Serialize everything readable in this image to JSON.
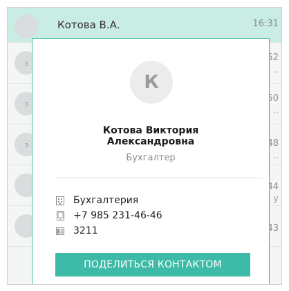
{
  "background_chats": [
    {
      "avatar": "",
      "name": "Котова В.А.",
      "time": "16:31",
      "sub": ""
    },
    {
      "avatar": "з",
      "name": "",
      "time": "52",
      "sub": ".."
    },
    {
      "avatar": "з",
      "name": "",
      "time": "50",
      "sub": ".."
    },
    {
      "avatar": "з",
      "name": "",
      "time": "48",
      "sub": ".."
    },
    {
      "avatar": "",
      "name": "",
      "time": "44",
      "sub": "у"
    },
    {
      "avatar": "",
      "name": "",
      "time": "43",
      "sub": ""
    }
  ],
  "contact": {
    "initial": "К",
    "name_line1": "Котова Виктория",
    "name_line2": "Александровна",
    "position": "Бухгалтер",
    "department": "Бухгалтерия",
    "phone": "+7  985 231-46-46",
    "extension": "3211"
  },
  "share_button_label": "ПОДЕЛИТЬСЯ КОНТАКТОМ",
  "colors": {
    "accent": "#3dbaa8",
    "active_row": "#c9ece4"
  },
  "icons": {
    "department": "building-icon",
    "phone": "mobile-phone-icon",
    "extension": "desk-phone-icon"
  }
}
